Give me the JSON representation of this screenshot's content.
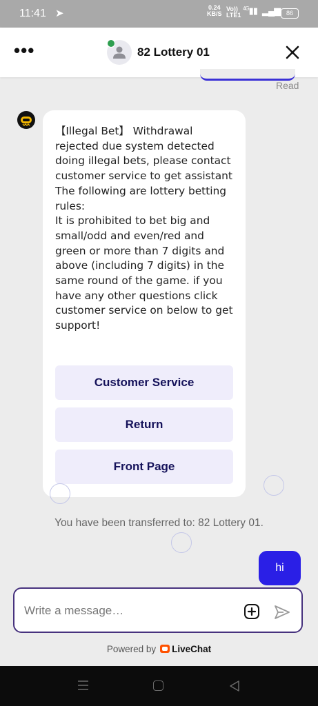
{
  "status_bar": {
    "time": "11:41",
    "speed_value": "0.24",
    "speed_unit": "KB/S",
    "network_top": "Vo))",
    "network_bottom": "LTE1",
    "network_type": "4G",
    "battery": "86"
  },
  "header": {
    "agent_name": "82 Lottery 01",
    "menu_icon": "more-horizontal-icon",
    "close_icon": "close-icon"
  },
  "previous_message": {
    "read_label": "Read"
  },
  "bot_message": {
    "text": "【Illegal Bet】 Withdrawal rejected due system detected doing illegal bets, please contact customer service to get assistant\nThe following are lottery betting rules:\nIt is prohibited to bet big and small/odd and even/red and green or more than 7 digits and above (including 7 digits) in the same round of the game. if you have any other questions click customer service on below to get support!",
    "buttons": [
      "Customer Service",
      "Return",
      "Front Page"
    ]
  },
  "system_message": "You have been transferred to: 82 Lottery 01.",
  "user_message": "hi",
  "composer": {
    "placeholder": "Write a message…"
  },
  "footer": {
    "powered_by": "Powered by",
    "brand": "LiveChat"
  },
  "colors": {
    "accent": "#2a1fe6",
    "quick_reply_bg": "#efedfb",
    "composer_border": "#47327e",
    "brand_orange": "#ff5100"
  }
}
